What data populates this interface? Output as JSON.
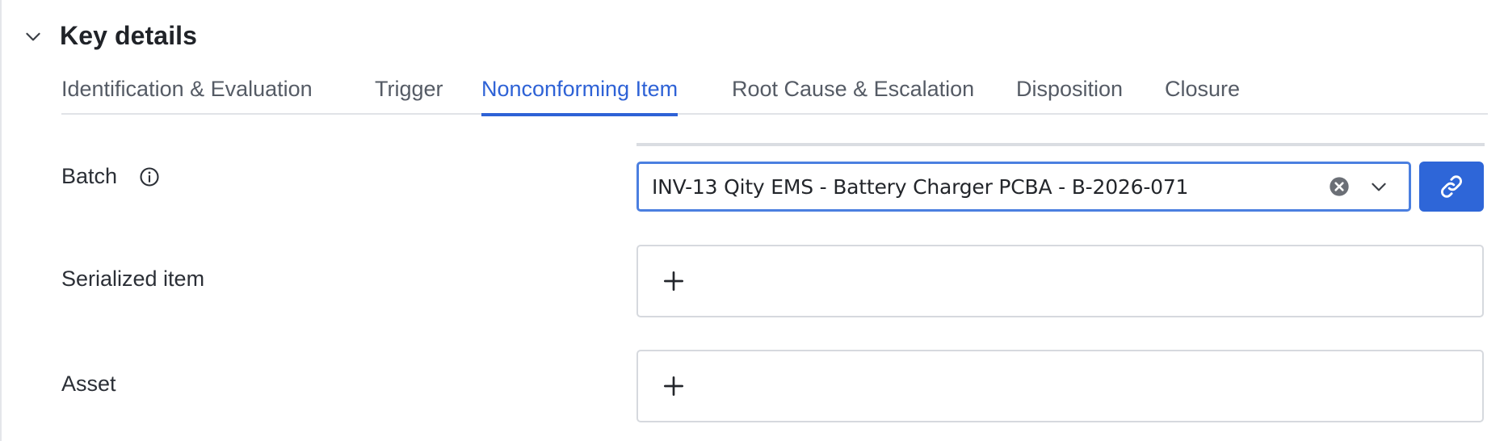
{
  "section": {
    "title": "Key details",
    "collapse_icon": "chevron-down-icon"
  },
  "tabs": [
    {
      "label": "Identification & Evaluation",
      "active": false
    },
    {
      "label": "Trigger",
      "active": false
    },
    {
      "label": "Nonconforming Item",
      "active": true
    },
    {
      "label": "Root Cause & Escalation",
      "active": false
    },
    {
      "label": "Disposition",
      "active": false
    },
    {
      "label": "Closure",
      "active": false
    }
  ],
  "fields": {
    "batch": {
      "label": "Batch",
      "info_icon": "info-icon",
      "value": "INV-13 Qity EMS - Battery Charger PCBA - B-2026-071",
      "clear_icon": "clear-icon",
      "dropdown_icon": "chevron-down-icon",
      "link_icon": "link-icon"
    },
    "serialized_item": {
      "label": "Serialized item",
      "add_icon": "plus-icon"
    },
    "asset": {
      "label": "Asset",
      "add_icon": "plus-icon"
    }
  },
  "colors": {
    "accent": "#2e62d6",
    "link_button": "#2e66d8",
    "focus_border": "#4b7fe0",
    "tab_inactive": "#555b65",
    "text": "#2b2f36"
  }
}
